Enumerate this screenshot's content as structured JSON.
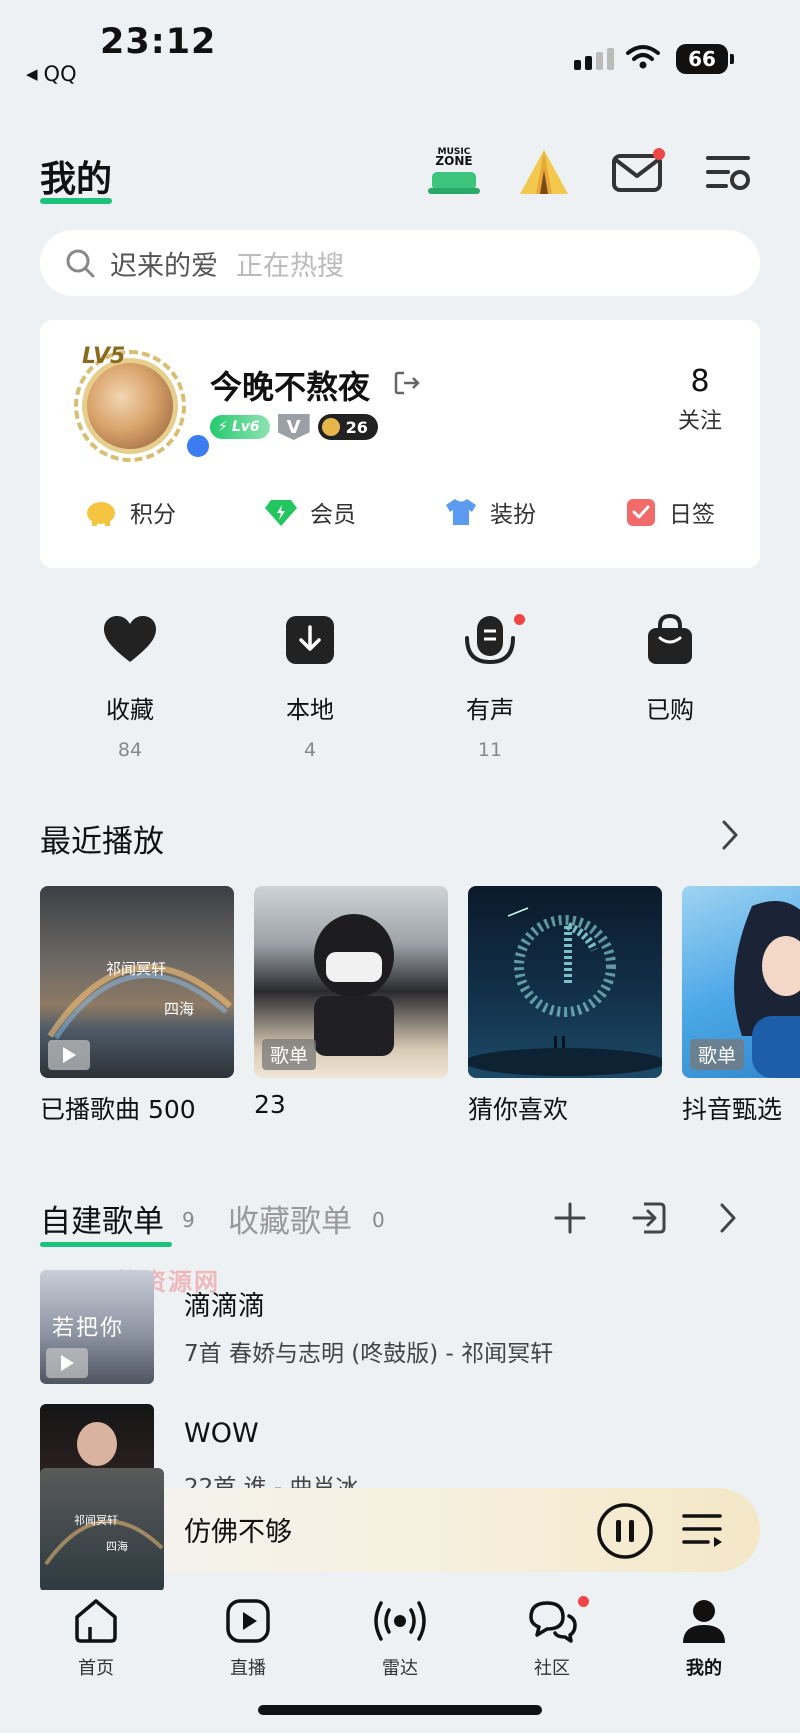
{
  "status_bar": {
    "time": "23:12",
    "back_app": "QQ",
    "battery": "66"
  },
  "header": {
    "title": "我的"
  },
  "search": {
    "query": "迟来的爱",
    "hint": "正在热搜"
  },
  "profile": {
    "level_badge": "LV5",
    "username": "今晚不熬夜",
    "vip_level": "Lv6",
    "vip_mark": "V",
    "badge_count": "26",
    "follow_count": "8",
    "follow_label": "关注",
    "actions": [
      {
        "label": "积分",
        "icon": "piggy-bank-icon",
        "color": "#f5c542"
      },
      {
        "label": "会员",
        "icon": "diamond-icon",
        "color": "#22c55e"
      },
      {
        "label": "装扮",
        "icon": "tshirt-icon",
        "color": "#5b9bf0"
      },
      {
        "label": "日签",
        "icon": "calendar-check-icon",
        "color": "#f26a6a"
      }
    ]
  },
  "quick": [
    {
      "label": "收藏",
      "count": "84",
      "icon": "heart-icon"
    },
    {
      "label": "本地",
      "count": "4",
      "icon": "download-icon"
    },
    {
      "label": "有声",
      "count": "11",
      "icon": "audio-icon"
    },
    {
      "label": "已购",
      "count": "",
      "icon": "bag-icon"
    }
  ],
  "recent": {
    "title": "最近播放",
    "items": [
      {
        "caption": "已播歌曲 500",
        "cover_text_1": "祁闻冥轩",
        "cover_text_2": "四海"
      },
      {
        "caption": "23",
        "tag": "歌单"
      },
      {
        "caption": "猜你喜欢"
      },
      {
        "caption": "抖音甄选",
        "tag": "歌单"
      }
    ]
  },
  "playlists": {
    "tab_created": "自建歌单",
    "tab_created_count": "9",
    "tab_saved": "收藏歌单",
    "tab_saved_count": "0",
    "items": [
      {
        "name": "滴滴滴",
        "meta": "7首 春娇与志明 (咚鼓版) - 祁闻冥轩",
        "thumb_text": "若把你"
      },
      {
        "name": "WOW",
        "meta": "22首 谁 - 曲肖冰"
      }
    ],
    "watermark": "天籁资源网"
  },
  "player": {
    "title": "仿佛不够",
    "disc_text_1": "祁闻冥轩",
    "disc_text_2": "四海"
  },
  "tabbar": [
    {
      "label": "首页",
      "icon": "home-icon"
    },
    {
      "label": "直播",
      "icon": "live-play-icon"
    },
    {
      "label": "雷达",
      "icon": "radar-icon"
    },
    {
      "label": "社区",
      "icon": "community-chat-icon"
    },
    {
      "label": "我的",
      "icon": "profile-icon"
    }
  ],
  "colors": {
    "accent": "#1bc27a",
    "notify": "#f04545",
    "background": "#eef1f4"
  }
}
